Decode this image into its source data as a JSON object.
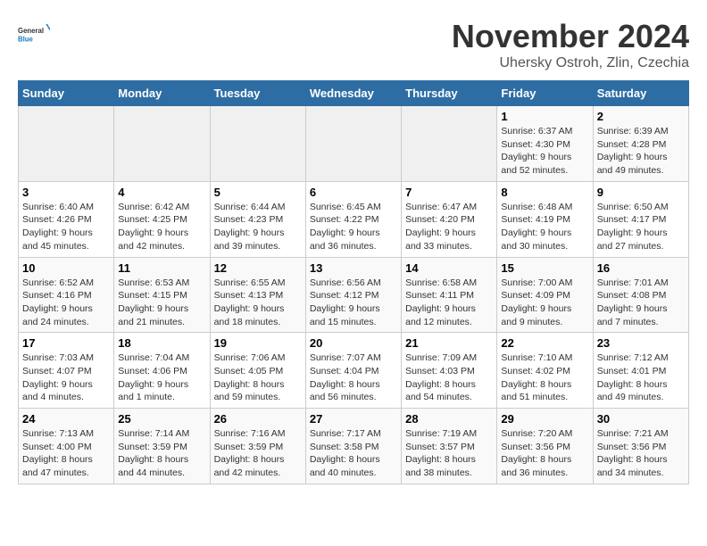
{
  "header": {
    "logo_text_general": "General",
    "logo_text_blue": "Blue",
    "month": "November 2024",
    "location": "Uhersky Ostroh, Zlin, Czechia"
  },
  "days_of_week": [
    "Sunday",
    "Monday",
    "Tuesday",
    "Wednesday",
    "Thursday",
    "Friday",
    "Saturday"
  ],
  "weeks": [
    [
      {
        "day": "",
        "info": ""
      },
      {
        "day": "",
        "info": ""
      },
      {
        "day": "",
        "info": ""
      },
      {
        "day": "",
        "info": ""
      },
      {
        "day": "",
        "info": ""
      },
      {
        "day": "1",
        "info": "Sunrise: 6:37 AM\nSunset: 4:30 PM\nDaylight: 9 hours and 52 minutes."
      },
      {
        "day": "2",
        "info": "Sunrise: 6:39 AM\nSunset: 4:28 PM\nDaylight: 9 hours and 49 minutes."
      }
    ],
    [
      {
        "day": "3",
        "info": "Sunrise: 6:40 AM\nSunset: 4:26 PM\nDaylight: 9 hours and 45 minutes."
      },
      {
        "day": "4",
        "info": "Sunrise: 6:42 AM\nSunset: 4:25 PM\nDaylight: 9 hours and 42 minutes."
      },
      {
        "day": "5",
        "info": "Sunrise: 6:44 AM\nSunset: 4:23 PM\nDaylight: 9 hours and 39 minutes."
      },
      {
        "day": "6",
        "info": "Sunrise: 6:45 AM\nSunset: 4:22 PM\nDaylight: 9 hours and 36 minutes."
      },
      {
        "day": "7",
        "info": "Sunrise: 6:47 AM\nSunset: 4:20 PM\nDaylight: 9 hours and 33 minutes."
      },
      {
        "day": "8",
        "info": "Sunrise: 6:48 AM\nSunset: 4:19 PM\nDaylight: 9 hours and 30 minutes."
      },
      {
        "day": "9",
        "info": "Sunrise: 6:50 AM\nSunset: 4:17 PM\nDaylight: 9 hours and 27 minutes."
      }
    ],
    [
      {
        "day": "10",
        "info": "Sunrise: 6:52 AM\nSunset: 4:16 PM\nDaylight: 9 hours and 24 minutes."
      },
      {
        "day": "11",
        "info": "Sunrise: 6:53 AM\nSunset: 4:15 PM\nDaylight: 9 hours and 21 minutes."
      },
      {
        "day": "12",
        "info": "Sunrise: 6:55 AM\nSunset: 4:13 PM\nDaylight: 9 hours and 18 minutes."
      },
      {
        "day": "13",
        "info": "Sunrise: 6:56 AM\nSunset: 4:12 PM\nDaylight: 9 hours and 15 minutes."
      },
      {
        "day": "14",
        "info": "Sunrise: 6:58 AM\nSunset: 4:11 PM\nDaylight: 9 hours and 12 minutes."
      },
      {
        "day": "15",
        "info": "Sunrise: 7:00 AM\nSunset: 4:09 PM\nDaylight: 9 hours and 9 minutes."
      },
      {
        "day": "16",
        "info": "Sunrise: 7:01 AM\nSunset: 4:08 PM\nDaylight: 9 hours and 7 minutes."
      }
    ],
    [
      {
        "day": "17",
        "info": "Sunrise: 7:03 AM\nSunset: 4:07 PM\nDaylight: 9 hours and 4 minutes."
      },
      {
        "day": "18",
        "info": "Sunrise: 7:04 AM\nSunset: 4:06 PM\nDaylight: 9 hours and 1 minute."
      },
      {
        "day": "19",
        "info": "Sunrise: 7:06 AM\nSunset: 4:05 PM\nDaylight: 8 hours and 59 minutes."
      },
      {
        "day": "20",
        "info": "Sunrise: 7:07 AM\nSunset: 4:04 PM\nDaylight: 8 hours and 56 minutes."
      },
      {
        "day": "21",
        "info": "Sunrise: 7:09 AM\nSunset: 4:03 PM\nDaylight: 8 hours and 54 minutes."
      },
      {
        "day": "22",
        "info": "Sunrise: 7:10 AM\nSunset: 4:02 PM\nDaylight: 8 hours and 51 minutes."
      },
      {
        "day": "23",
        "info": "Sunrise: 7:12 AM\nSunset: 4:01 PM\nDaylight: 8 hours and 49 minutes."
      }
    ],
    [
      {
        "day": "24",
        "info": "Sunrise: 7:13 AM\nSunset: 4:00 PM\nDaylight: 8 hours and 47 minutes."
      },
      {
        "day": "25",
        "info": "Sunrise: 7:14 AM\nSunset: 3:59 PM\nDaylight: 8 hours and 44 minutes."
      },
      {
        "day": "26",
        "info": "Sunrise: 7:16 AM\nSunset: 3:59 PM\nDaylight: 8 hours and 42 minutes."
      },
      {
        "day": "27",
        "info": "Sunrise: 7:17 AM\nSunset: 3:58 PM\nDaylight: 8 hours and 40 minutes."
      },
      {
        "day": "28",
        "info": "Sunrise: 7:19 AM\nSunset: 3:57 PM\nDaylight: 8 hours and 38 minutes."
      },
      {
        "day": "29",
        "info": "Sunrise: 7:20 AM\nSunset: 3:56 PM\nDaylight: 8 hours and 36 minutes."
      },
      {
        "day": "30",
        "info": "Sunrise: 7:21 AM\nSunset: 3:56 PM\nDaylight: 8 hours and 34 minutes."
      }
    ]
  ]
}
